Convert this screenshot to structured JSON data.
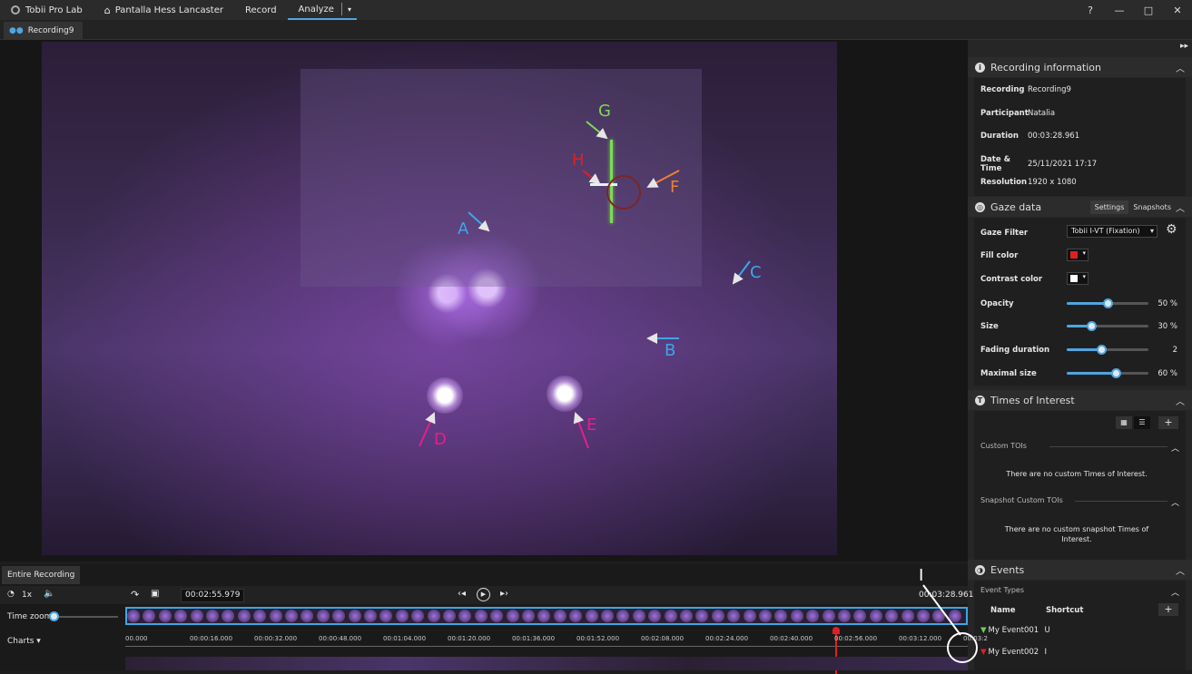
{
  "topbar": {
    "app_name": "Tobii Pro Lab",
    "project": "Pantalla Hess Lancaster",
    "record": "Record",
    "analyze": "Analyze",
    "help_icon": "?",
    "minimize_icon": "—",
    "maximize_icon": "□",
    "close_icon": "✕"
  },
  "tab": {
    "label": "Recording9"
  },
  "annotations": [
    {
      "letter": "A",
      "color": "#3ba7e6"
    },
    {
      "letter": "B",
      "color": "#3ba7e6"
    },
    {
      "letter": "C",
      "color": "#3ba7e6"
    },
    {
      "letter": "D",
      "color": "#e0218a"
    },
    {
      "letter": "E",
      "color": "#e0218a"
    },
    {
      "letter": "F",
      "color": "#f08030"
    },
    {
      "letter": "G",
      "color": "#7ed957"
    },
    {
      "letter": "H",
      "color": "#e02020"
    }
  ],
  "recording_info": {
    "title": "Recording information",
    "rows": [
      {
        "label": "Recording",
        "value": "Recording9"
      },
      {
        "label": "Participant",
        "value": "Natalia"
      },
      {
        "label": "Duration",
        "value": "00:03:28.961"
      },
      {
        "label": "Date & Time",
        "value": "25/11/2021 17:17"
      },
      {
        "label": "Resolution",
        "value": "1920 x 1080"
      }
    ]
  },
  "gaze": {
    "title": "Gaze data",
    "tab_settings": "Settings",
    "tab_snapshots": "Snapshots",
    "filter_label": "Gaze Filter",
    "filter_value": "Tobii I-VT (Fixation)",
    "fill_label": "Fill color",
    "contrast_label": "Contrast color",
    "fill_color": "#e02020",
    "contrast_color": "#ffffff",
    "sliders": [
      {
        "label": "Opacity",
        "value": "50 %",
        "fraction": 0.5
      },
      {
        "label": "Size",
        "value": "30 %",
        "fraction": 0.3
      },
      {
        "label": "Fading duration",
        "value": "2",
        "fraction": 0.42
      },
      {
        "label": "Maximal size",
        "value": "60 %",
        "fraction": 0.6
      }
    ]
  },
  "toi": {
    "title": "Times of Interest",
    "custom_label": "Custom TOIs",
    "custom_empty": "There are no custom Times of Interest.",
    "snapshot_label": "Snapshot Custom TOIs",
    "snapshot_empty": "There are no custom snapshot Times of Interest."
  },
  "events": {
    "title": "Events",
    "types_label": "Event Types",
    "col_name": "Name",
    "col_shortcut": "Shortcut",
    "items": [
      {
        "name": "My Event001",
        "shortcut": "U",
        "color": "#6fcf50"
      },
      {
        "name": "My Event002",
        "shortcut": "I",
        "color": "#e02020"
      }
    ]
  },
  "timeline": {
    "tab": "Entire Recording",
    "speed": "1x",
    "current_time": "00:02:55.979",
    "total_time": "00:03:28.961",
    "time_zoom": "Time zoom",
    "charts": "Charts",
    "ticks": [
      "00.000",
      "00:00:16.000",
      "00:00:32.000",
      "00:00:48.000",
      "00:01:04.000",
      "00:01:20.000",
      "00:01:36.000",
      "00:01:52.000",
      "00:02:08.000",
      "00:02:24.000",
      "00:02:40.000",
      "00:02:56.000",
      "00:03:12.000",
      "00:03:2"
    ]
  }
}
